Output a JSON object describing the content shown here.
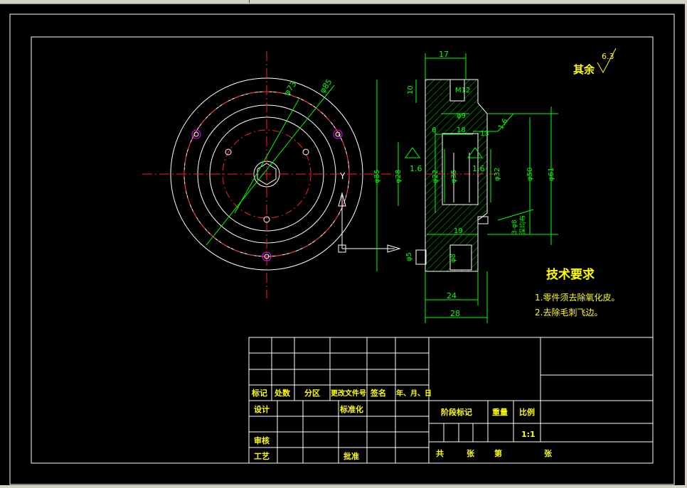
{
  "surface_finish": {
    "label": "其余",
    "value": "6.3"
  },
  "dimensions": {
    "d17": "17",
    "d10": "10",
    "m12": "M12",
    "phi9": "φ9",
    "d6": "6",
    "d18": "18",
    "d13": "13",
    "r16": "1.6",
    "ra16_a": "1.6",
    "ra16_b": "1.6",
    "d19": "19",
    "d24": "24",
    "d28": "28",
    "phi5": "φ5",
    "phi8": "φ8",
    "phi85": "φ85",
    "phi28": "φ28",
    "phi22": "φ22",
    "phi35": "φ35",
    "phi32": "φ32",
    "phi50": "φ50",
    "phi61": "φ61",
    "phi73": "φ73",
    "phi85b": "φ85",
    "hole_note": "3-φ8",
    "hole_note2": "深均布"
  },
  "tech_req": {
    "title": "技术要求",
    "items": [
      "1.零件须去除氧化皮。",
      "2.去除毛刺飞边。"
    ]
  },
  "title_block": {
    "row_labels": [
      "标记",
      "处数",
      "分区",
      "更改文件号",
      "签名",
      "年、月、日"
    ],
    "design": "设计",
    "standard": "标准化",
    "review": "审核",
    "process": "工艺",
    "approve": "批准",
    "stage_mark": "阶段标记",
    "weight": "重量",
    "scale": "比例",
    "scale_value": "1:1",
    "sheets_total": "共",
    "sheets_unit": "张",
    "sheet_no": "第",
    "sheet_unit2": "张"
  },
  "colors": {
    "frame": "#ffffff",
    "dims": "#00ff00",
    "center": "#ff2020",
    "hatch": "#00ff00",
    "text": "#ffff00",
    "accent": "#ff00ff"
  }
}
